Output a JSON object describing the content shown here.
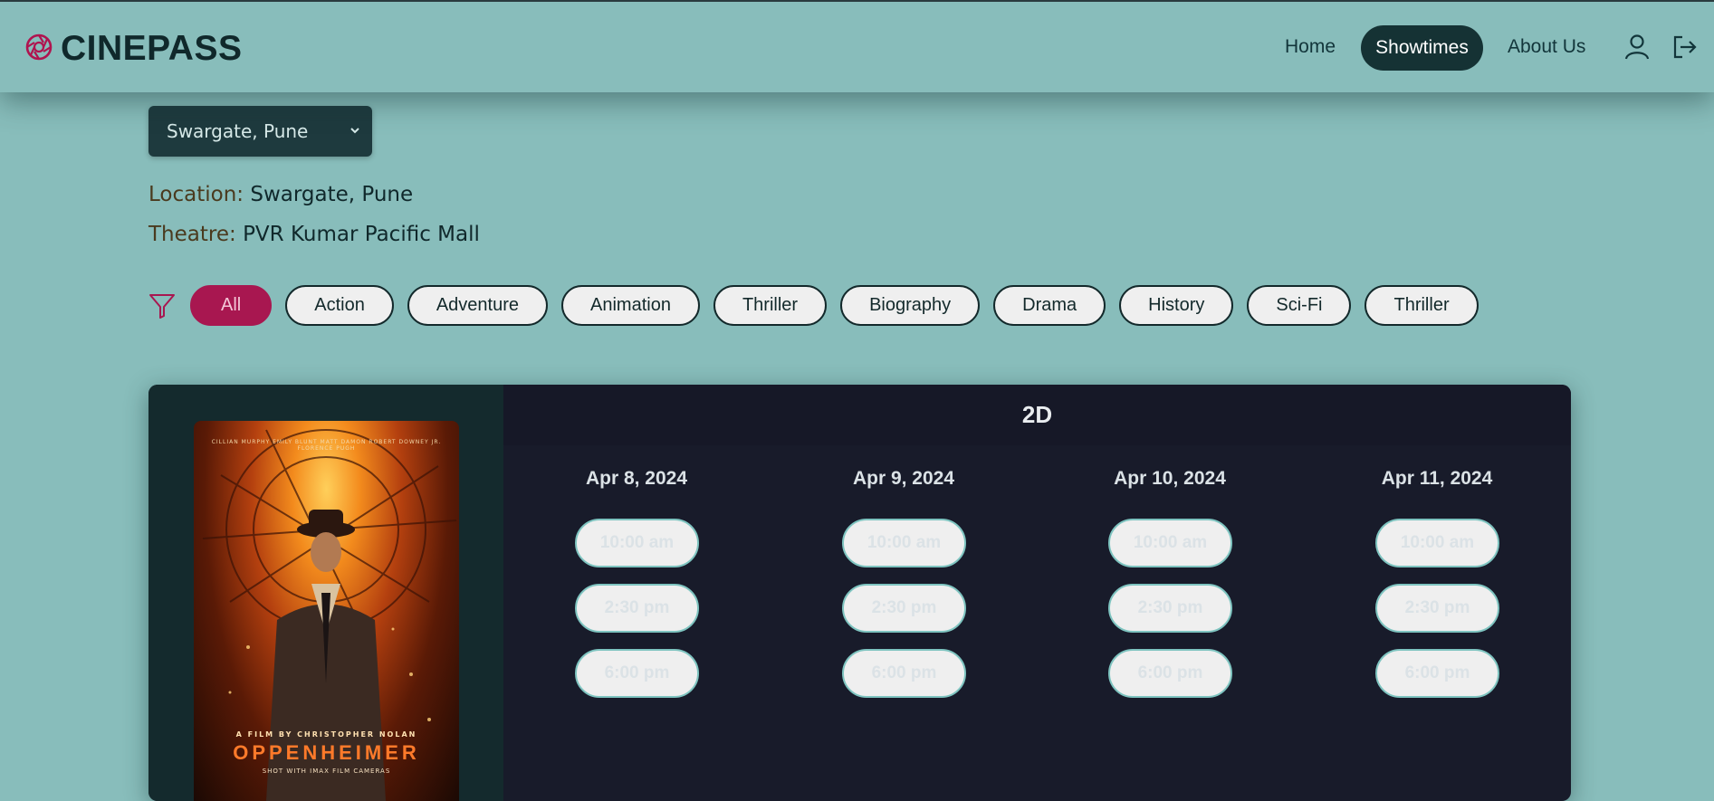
{
  "brand": {
    "name": "CINEPASS"
  },
  "nav": {
    "items": [
      {
        "label": "Home",
        "active": false
      },
      {
        "label": "Showtimes",
        "active": true
      },
      {
        "label": "About Us",
        "active": false
      }
    ],
    "icons": [
      "user-icon",
      "logout-icon"
    ]
  },
  "location_select": {
    "value": "Swargate, Pune"
  },
  "info": {
    "location_label": "Location:",
    "location_value": "Swargate, Pune",
    "theatre_label": "Theatre:",
    "theatre_value": "PVR Kumar Pacific Mall"
  },
  "filters": {
    "icon": "filter-icon",
    "genres": [
      "All",
      "Action",
      "Adventure",
      "Animation",
      "Thriller",
      "Biography",
      "Drama",
      "History",
      "Sci-Fi",
      "Thriller"
    ],
    "selected": "All"
  },
  "movie": {
    "poster": {
      "credits": "CILLIAN MURPHY    EMILY BLUNT    MATT DAMON    ROBERT DOWNEY JR.    FLORENCE PUGH",
      "director_line": "A FILM BY CHRISTOPHER NOLAN",
      "title": "OPPENHEIMER",
      "tagline": "SHOT WITH IMAX FILM CAMERAS"
    },
    "format": "2D",
    "days": [
      {
        "date": "Apr 8, 2024",
        "times": [
          "10:00 am",
          "2:30 pm",
          "6:00 pm"
        ]
      },
      {
        "date": "Apr 9, 2024",
        "times": [
          "10:00 am",
          "2:30 pm",
          "6:00 pm"
        ]
      },
      {
        "date": "Apr 10, 2024",
        "times": [
          "10:00 am",
          "2:30 pm",
          "6:00 pm"
        ]
      },
      {
        "date": "Apr 11, 2024",
        "times": [
          "10:00 am",
          "2:30 pm",
          "6:00 pm"
        ]
      }
    ]
  },
  "colors": {
    "background": "#88bdbb",
    "accent": "#a81750",
    "dark": "#153234",
    "card": "#181b2a",
    "time_border": "#7ec4c0"
  }
}
